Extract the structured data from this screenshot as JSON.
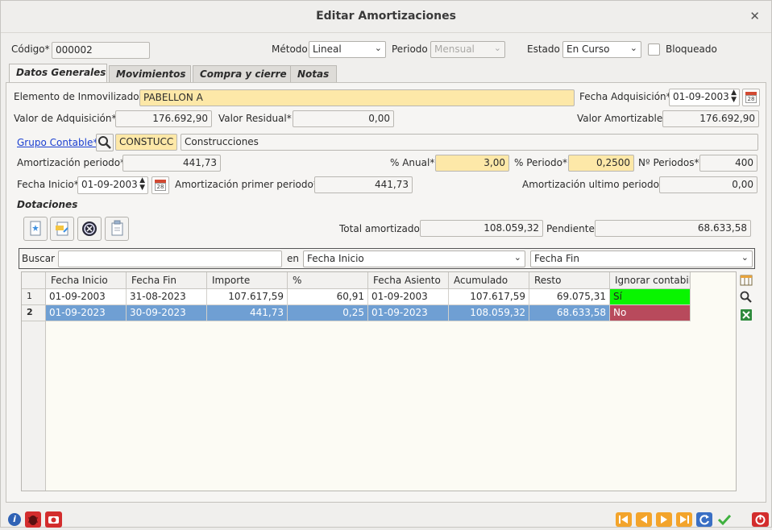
{
  "window": {
    "title": "Editar Amortizaciones"
  },
  "header": {
    "codigo_label": "Código*",
    "codigo_value": "000002",
    "metodo_label": "Método",
    "metodo_value": "Lineal",
    "periodo_label": "Periodo",
    "periodo_value": "Mensual",
    "estado_label": "Estado",
    "estado_value": "En Curso",
    "bloqueado_label": "Bloqueado"
  },
  "tabs": [
    {
      "label": "Datos Generales"
    },
    {
      "label": "Movimientos"
    },
    {
      "label": "Compra y cierre"
    },
    {
      "label": "Notas"
    }
  ],
  "form": {
    "elemento_label": "Elemento de Inmovilizado*",
    "elemento_value": "PABELLON A",
    "fecha_adq_label": "Fecha Adquisición*",
    "fecha_adq_value": "01-09-2003",
    "valor_adq_label": "Valor de Adquisición*",
    "valor_adq_value": "176.692,90",
    "valor_res_label": "Valor Residual*",
    "valor_res_value": "0,00",
    "valor_amort_label": "Valor Amortizable",
    "valor_amort_value": "176.692,90",
    "grupo_label": "Grupo Contable*",
    "grupo_code": "CONSTUCC",
    "grupo_desc": "Construcciones",
    "amort_periodo_label": "Amortización periodo*",
    "amort_periodo_value": "441,73",
    "anual_label": "% Anual*",
    "anual_value": "3,00",
    "pct_periodo_label": "% Periodo*",
    "pct_periodo_value": "0,2500",
    "nperiodos_label": "Nº Periodos*",
    "nperiodos_value": "400",
    "fecha_inicio_label": "Fecha Inicio*",
    "fecha_inicio_value": "01-09-2003",
    "amort_primer_label": "Amortización primer periodo*",
    "amort_primer_value": "441,73",
    "amort_ultimo_label": "Amortización ultimo periodo*",
    "amort_ultimo_value": "0,00"
  },
  "dotaciones": {
    "title": "Dotaciones",
    "total_label": "Total amortizado",
    "total_value": "108.059,32",
    "pendiente_label": "Pendiente",
    "pendiente_value": "68.633,58",
    "buscar_label": "Buscar",
    "buscar_value": "",
    "en_label": "en",
    "en_value": "Fecha Inicio",
    "sort_value": "Fecha Fin"
  },
  "table": {
    "columns": [
      "Fecha Inicio",
      "Fecha Fin",
      "Importe",
      "%",
      "Fecha Asiento",
      "Acumulado",
      "Resto",
      "Ignorar contabili"
    ],
    "rows": [
      {
        "n": "1",
        "cells": [
          "01-09-2003",
          "31-08-2023",
          "107.617,59",
          "60,91",
          "01-09-2003",
          "107.617,59",
          "69.075,31",
          "Sí"
        ]
      },
      {
        "n": "2",
        "cells": [
          "01-09-2023",
          "30-09-2023",
          "441,73",
          "0,25",
          "01-09-2023",
          "108.059,32",
          "68.633,58",
          "No"
        ]
      }
    ]
  },
  "calendar_num": "28",
  "colors": {
    "accent_yellow": "#fde8a8",
    "selected_row": "#6f9fd3",
    "yes_green": "#09f500",
    "no_red": "#b84a5c"
  }
}
